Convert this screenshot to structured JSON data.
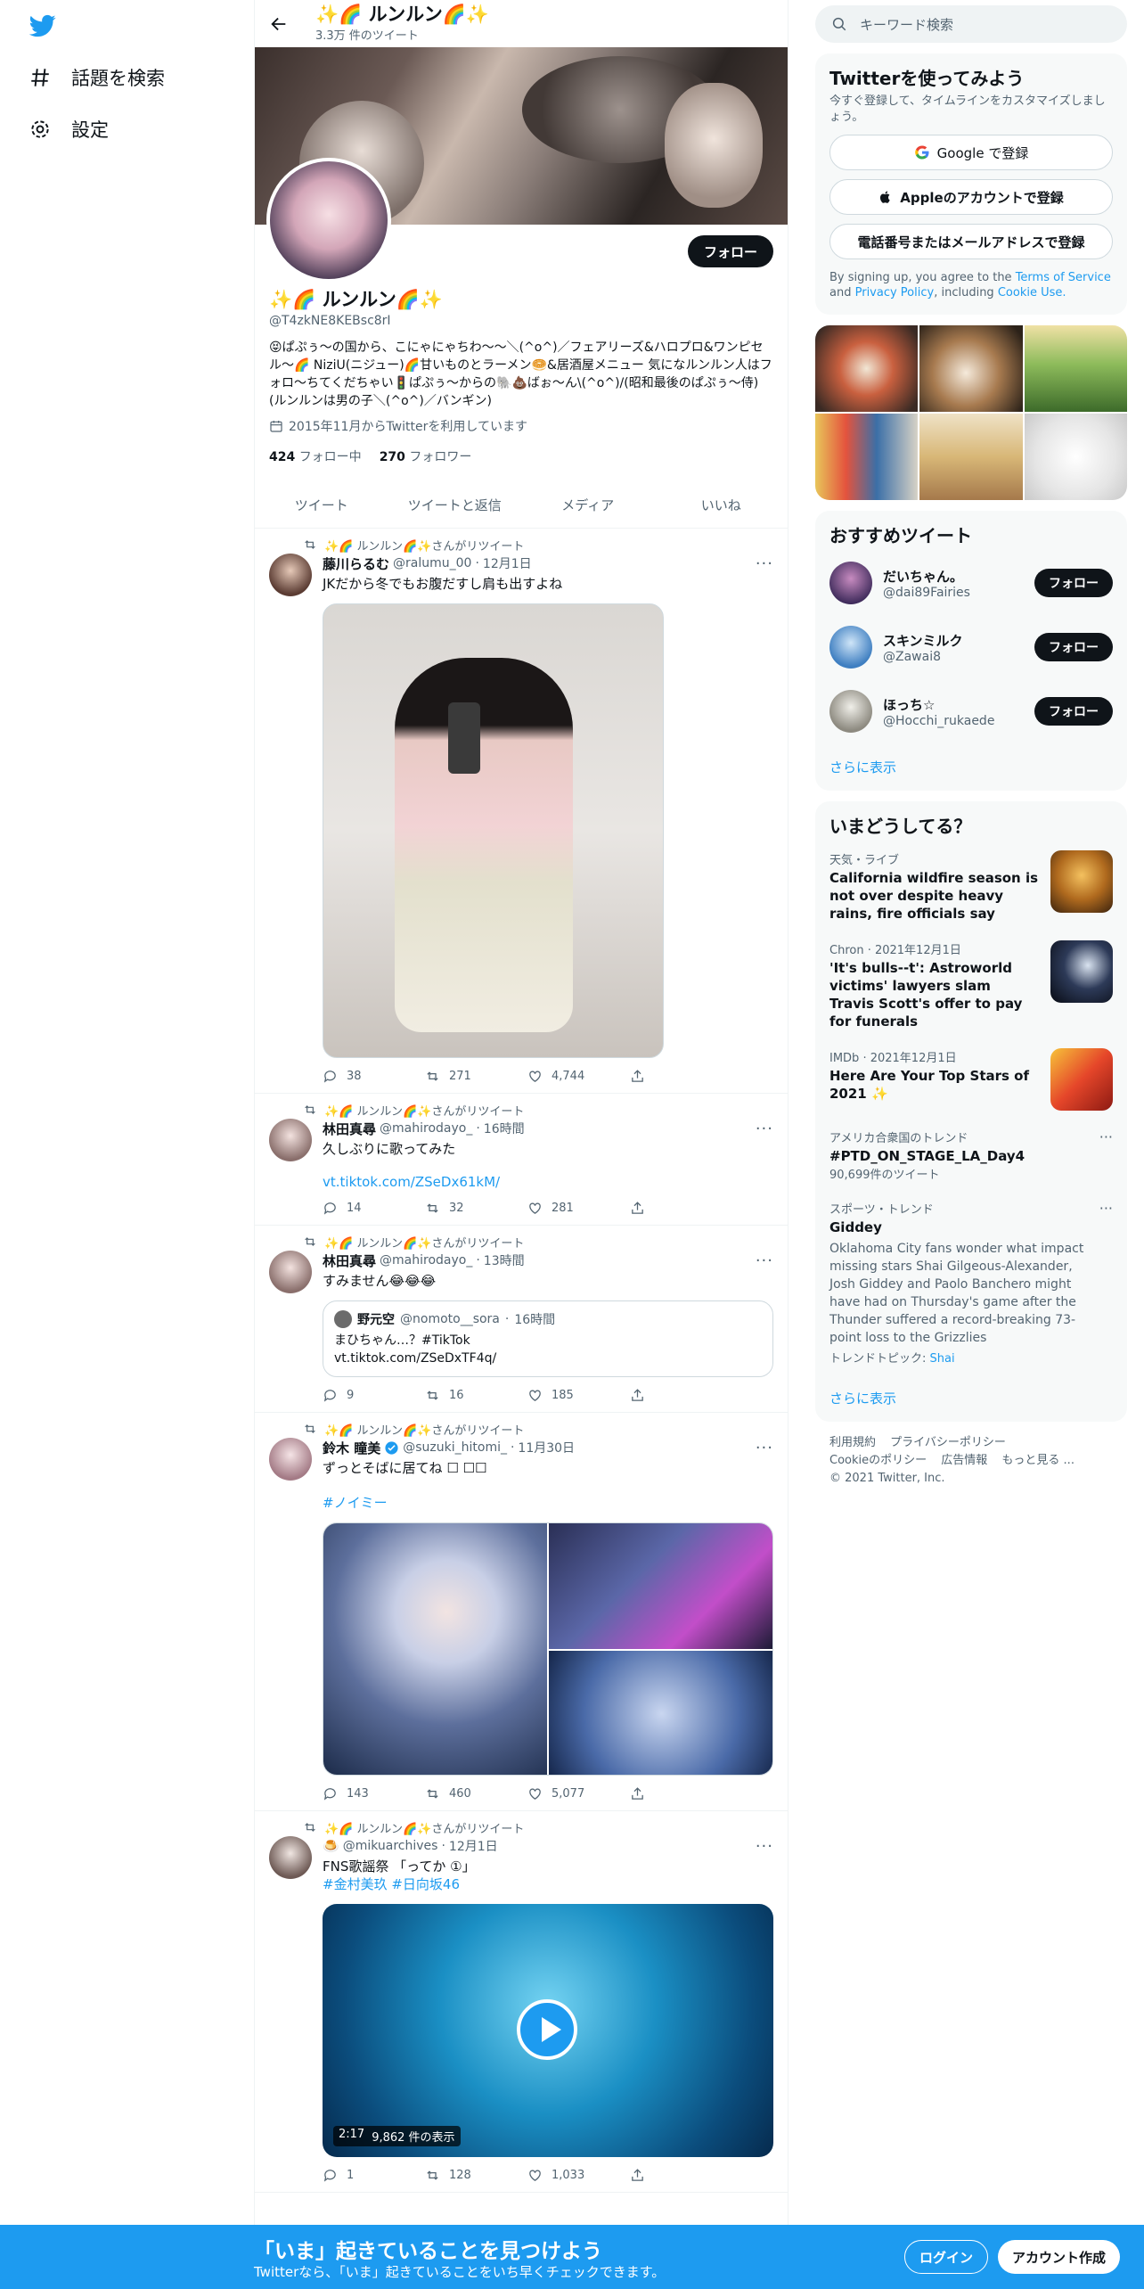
{
  "nav": {
    "explore_label": "話題を検索",
    "settings_label": "設定"
  },
  "profile": {
    "display_name": "✨🌈 ルンルン🌈✨",
    "tweet_count": "3.3万 件のツイート",
    "handle": "@T4zkNE8KEBsc8rI",
    "bio": "😝ぱぷぅ〜の国から、こにゃにゃちわ〜〜＼(^o^)／フェアリーズ&ハロプロ&ワンピセル〜🌈 NiziU(ニジュー)🌈甘いものとラーメン🥯&居酒屋メニュー 気になルンルン人はフォロ〜ちてくだちゃい🚦ぱぷぅ〜からの🐘💩ばぉ〜ん\\(^o^)/(昭和最後のぱぷぅ〜侍)(ルンルンは男の子＼(^o^)／バンギン)",
    "joined": "2015年11月からTwitterを利用しています",
    "following_count": "424",
    "following_label": "フォロー中",
    "followers_count": "270",
    "followers_label": "フォロワー",
    "follow_button": "フォロー"
  },
  "tabs": [
    "ツイート",
    "ツイートと返信",
    "メディア",
    "いいね"
  ],
  "retweet_label": "✨🌈 ルンルン🌈✨さんがリツイート",
  "tweets": [
    {
      "name": "藤川らるむ",
      "handle": "@ralumu_00",
      "time": "12月1日",
      "text": "JKだから冬でもお腹だすし肩も出すよね",
      "replies": "38",
      "retweets": "271",
      "likes": "4,744"
    },
    {
      "name": "林田真尋",
      "handle": "@mahirodayo_",
      "time": "16時間",
      "text": "久しぶりに歌ってみた",
      "link": "vt.tiktok.com/ZSeDx61kM/",
      "replies": "14",
      "retweets": "32",
      "likes": "281"
    },
    {
      "name": "林田真尋",
      "handle": "@mahirodayo_",
      "time": "13時間",
      "text": "すみません😂😂😂",
      "quote": {
        "name": "野元空",
        "handle": "@nomoto__sora",
        "time": "16時間",
        "text": "まひちゃん…？#TikTok\nvt.tiktok.com/ZSeDxTF4q/"
      },
      "replies": "9",
      "retweets": "16",
      "likes": "185"
    },
    {
      "name": "鈴木 瞳美",
      "handle": "@suzuki_hitomi_",
      "time": "11月30日",
      "text": "ずっとそばに居てね ☐ ☐☐",
      "hashtag": "#ノイミー",
      "replies": "143",
      "retweets": "460",
      "likes": "5,077"
    },
    {
      "name": "🍮",
      "handle": "@mikuarchives",
      "time": "12月1日",
      "text": "FNS歌謡祭 「ってか ①」",
      "hashtags": "#金村美玖 #日向坂46",
      "video_time": "2:17",
      "video_views": "9,862 件の表示",
      "replies": "1",
      "retweets": "128",
      "likes": "1,033"
    }
  ],
  "right": {
    "search_placeholder": "キーワード検索",
    "signup": {
      "title": "Twitterを使ってみよう",
      "subtitle": "今すぐ登録して、タイムラインをカスタマイズしましょう。",
      "google": "Google で登録",
      "apple": "Appleのアカウントで登録",
      "phone": "電話番号またはメールアドレスで登録",
      "terms_pre": "By signing up, you agree to the",
      "terms_tos": "Terms of Service",
      "terms_and": "and",
      "terms_privacy": "Privacy Policy",
      "terms_including": ", including",
      "terms_cookie": "Cookie Use."
    },
    "recommended": {
      "title": "おすすめツイート",
      "users": [
        {
          "name": "だいちゃん。",
          "handle": "@dai89Fairies",
          "button": "フォロー"
        },
        {
          "name": "スキンミルク",
          "handle": "@Zawai8",
          "button": "フォロー"
        },
        {
          "name": "ほっち☆",
          "handle": "@Hocchi_rukaede",
          "button": "フォロー"
        }
      ],
      "more": "さらに表示"
    },
    "trends": {
      "title": "いまどうしてる？",
      "items": [
        {
          "category": "天気・ライブ",
          "title": "California wildfire season is not over despite heavy rains, fire officials say"
        },
        {
          "category": "Chron · 2021年12月1日",
          "title": "'It's bulls--t': Astroworld victims' lawyers slam Travis Scott's offer to pay for funerals"
        },
        {
          "category": "IMDb · 2021年12月1日",
          "title": "Here Are Your Top Stars of 2021 ✨"
        },
        {
          "category": "アメリカ合衆国のトレンド",
          "title": "#PTD_ON_STAGE_LA_Day4",
          "count": "90,699件のツイート"
        },
        {
          "category": "スポーツ・トレンド",
          "title": "Giddey",
          "desc": "Oklahoma City fans wonder what impact missing stars Shai Gilgeous-Alexander, Josh Giddey and Paolo Banchero might have had on Thursday's game after the Thunder suffered a record-breaking 73-point loss to the Grizzlies",
          "topic_label": "トレンドトピック:",
          "topic": "Shai"
        }
      ],
      "more": "さらに表示"
    },
    "footer": {
      "terms": "利用規約",
      "privacy": "プライバシーポリシー",
      "cookie": "Cookieのポリシー",
      "ads": "広告情報",
      "more": "もっと見る ...",
      "copyright": "© 2021 Twitter, Inc."
    }
  },
  "bottom": {
    "title": "「いま」起きていることを見つけよう",
    "subtitle": "Twitterなら、「いま」起きていることをいち早くチェックできます。",
    "login": "ログイン",
    "signup": "アカウント作成"
  },
  "colors": {
    "accent": "#1d9bf0",
    "text": "#0f1419",
    "muted": "#536471",
    "border": "#eff3f4"
  }
}
